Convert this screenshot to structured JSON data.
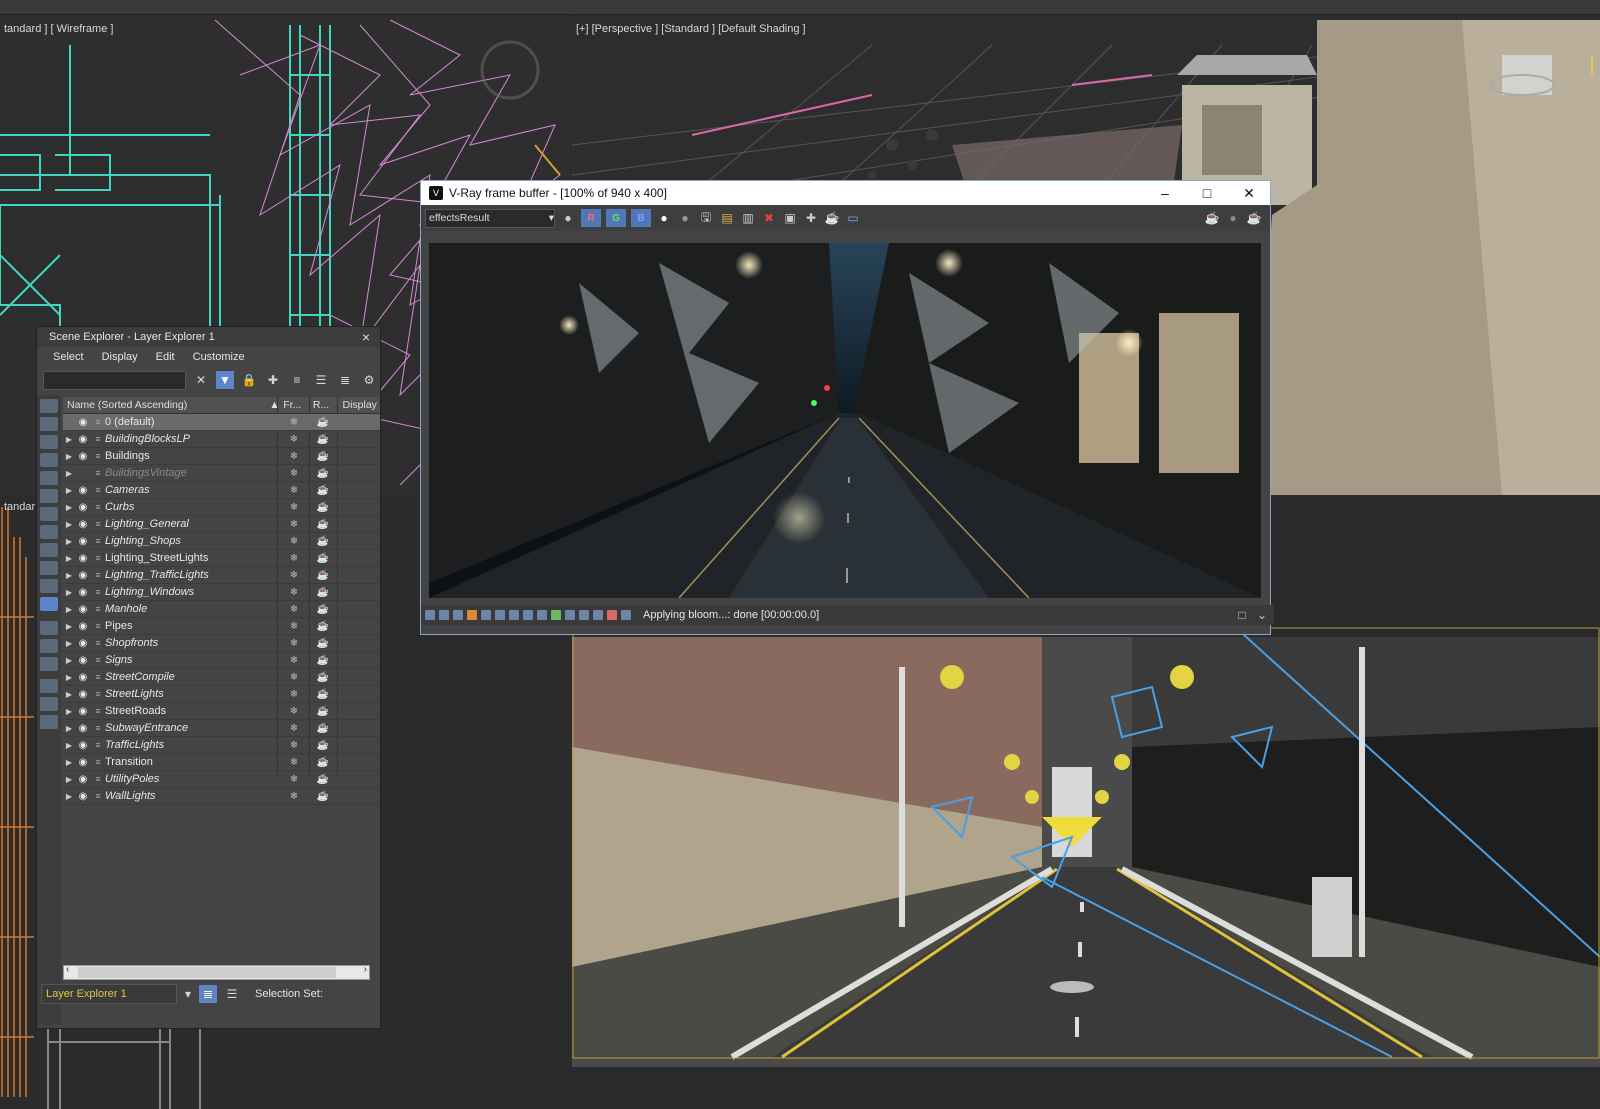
{
  "viewports": {
    "top_left_label": "tandard ] [ Wireframe ]",
    "top_right_label": "[+] [Perspective ] [Standard ] [Default Shading ]",
    "left_mid_label": "tandar"
  },
  "scene_explorer": {
    "title": "Scene Explorer - Layer Explorer 1",
    "close": "×",
    "menu": [
      "Select",
      "Display",
      "Edit",
      "Customize"
    ],
    "search_placeholder": "",
    "columns": {
      "name": "Name (Sorted Ascending)",
      "frozen": "Fr...",
      "render": "R...",
      "display": "Display"
    },
    "layers": [
      {
        "name": "0 (default)",
        "italic": false,
        "dim": false,
        "selected": true
      },
      {
        "name": "BuildingBlocksLP",
        "italic": true,
        "dim": false
      },
      {
        "name": "Buildings",
        "italic": false,
        "dim": false
      },
      {
        "name": "BuildingsVintage",
        "italic": true,
        "dim": true
      },
      {
        "name": "Cameras",
        "italic": true,
        "dim": false
      },
      {
        "name": "Curbs",
        "italic": true,
        "dim": false
      },
      {
        "name": "Lighting_General",
        "italic": true,
        "dim": false
      },
      {
        "name": "Lighting_Shops",
        "italic": true,
        "dim": false
      },
      {
        "name": "Lighting_StreetLights",
        "italic": false,
        "dim": false
      },
      {
        "name": "Lighting_TrafficLights",
        "italic": true,
        "dim": false
      },
      {
        "name": "Lighting_Windows",
        "italic": true,
        "dim": false
      },
      {
        "name": "Manhole",
        "italic": true,
        "dim": false
      },
      {
        "name": "Pipes",
        "italic": false,
        "dim": false
      },
      {
        "name": "Shopfronts",
        "italic": true,
        "dim": false
      },
      {
        "name": "Signs",
        "italic": true,
        "dim": false
      },
      {
        "name": "StreetCompile",
        "italic": true,
        "dim": false
      },
      {
        "name": "StreetLights",
        "italic": true,
        "dim": false
      },
      {
        "name": "StreetRoads",
        "italic": false,
        "dim": false
      },
      {
        "name": "SubwayEntrance",
        "italic": true,
        "dim": false
      },
      {
        "name": "TrafficLights",
        "italic": true,
        "dim": false
      },
      {
        "name": "Transition",
        "italic": false,
        "dim": false
      },
      {
        "name": "UtilityPoles",
        "italic": true,
        "dim": false
      },
      {
        "name": "WallLights",
        "italic": true,
        "dim": false
      }
    ],
    "explorer_dropdown": "Layer Explorer 1",
    "selection_set_label": "Selection Set:"
  },
  "vfb": {
    "title": "V-Ray frame buffer - [100% of 940 x 400]",
    "channel": "effectsResult",
    "rgb": [
      "R",
      "G",
      "B"
    ],
    "status": "Applying bloom...: done [00:00:00.0]"
  },
  "colors": {
    "accent_blue": "#5c86c9",
    "wire_cyan": "#3fd7c0",
    "wire_pink": "#d58ad6",
    "wire_orange": "#d87a2e",
    "selection_yellow": "#e6c44a"
  }
}
